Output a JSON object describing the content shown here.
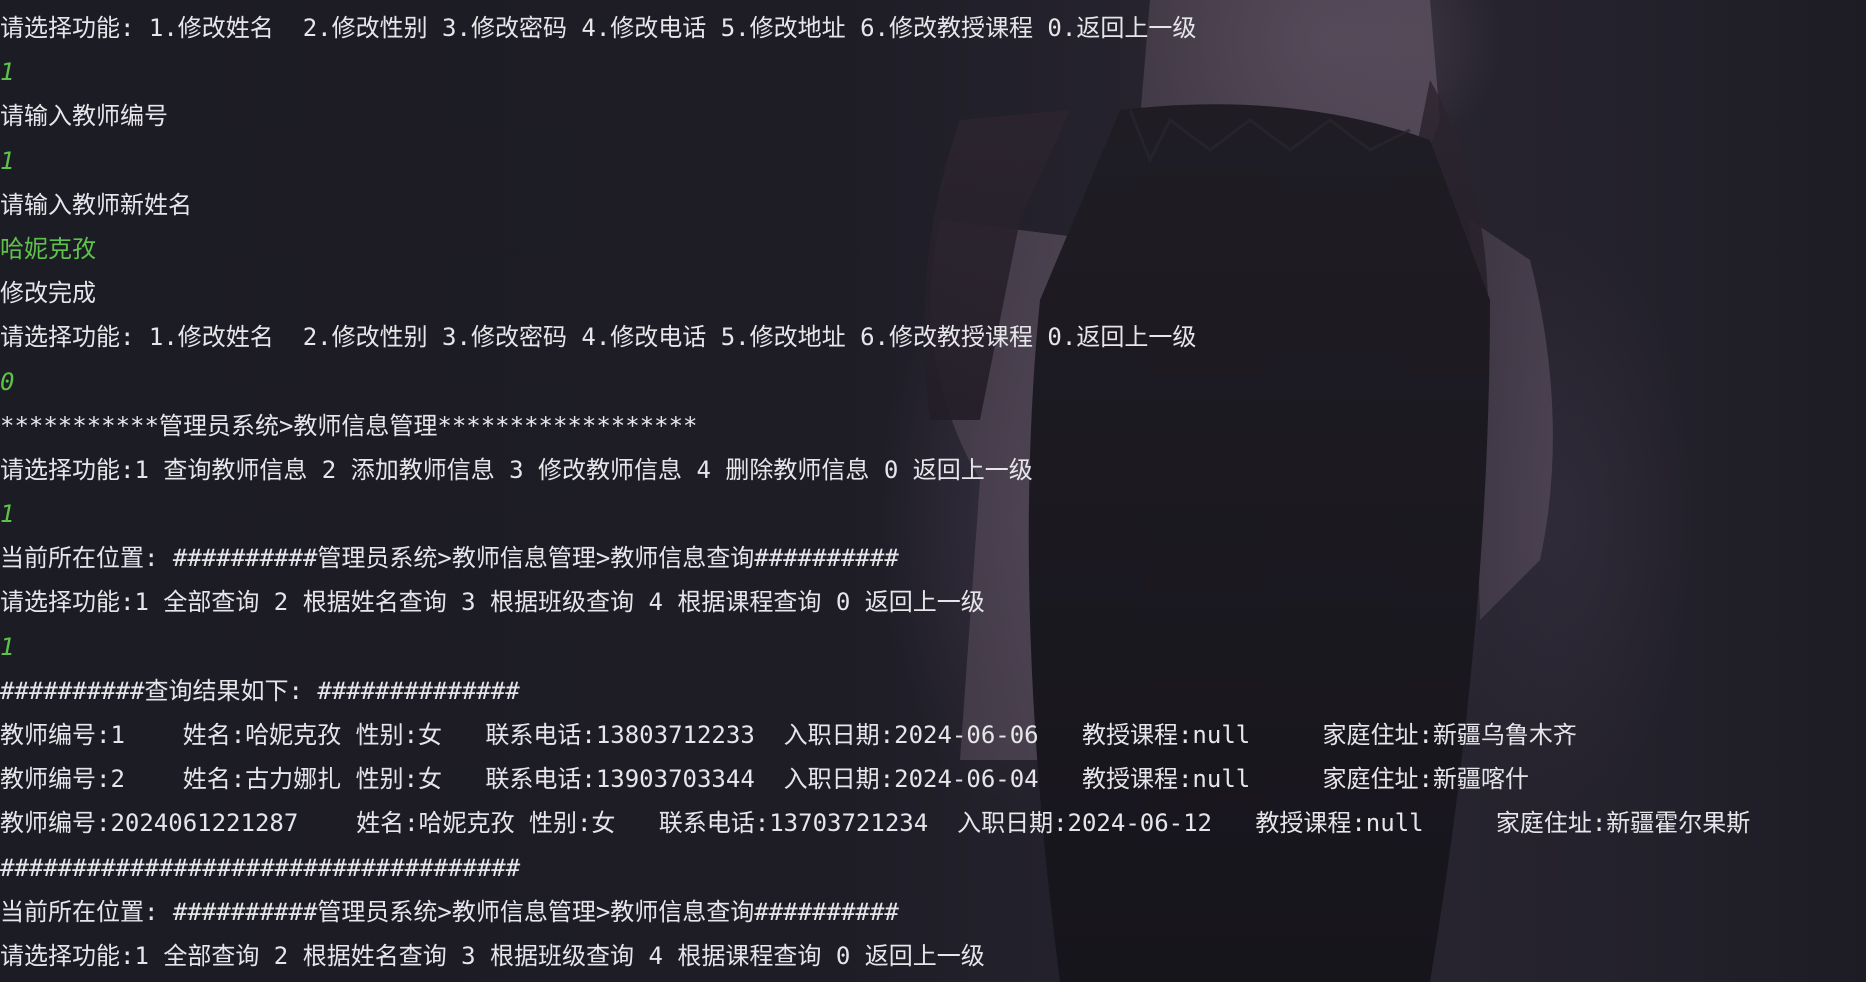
{
  "terminal": {
    "lines": [
      {
        "text": "请选择功能: 1.修改姓名  2.修改性别 3.修改密码 4.修改电话 5.修改地址 6.修改教授课程 0.返回上一级",
        "kind": "output"
      },
      {
        "text": "1",
        "kind": "input"
      },
      {
        "text": "请输入教师编号",
        "kind": "output"
      },
      {
        "text": "1",
        "kind": "input"
      },
      {
        "text": "请输入教师新姓名",
        "kind": "output"
      },
      {
        "text": "哈妮克孜",
        "kind": "input"
      },
      {
        "text": "修改完成",
        "kind": "output"
      },
      {
        "text": "请选择功能: 1.修改姓名  2.修改性别 3.修改密码 4.修改电话 5.修改地址 6.修改教授课程 0.返回上一级",
        "kind": "output"
      },
      {
        "text": "0",
        "kind": "input"
      },
      {
        "text": "***********管理员系统>教师信息管理******************",
        "kind": "output"
      },
      {
        "text": "请选择功能:1 查询教师信息 2 添加教师信息 3 修改教师信息 4 删除教师信息 0 返回上一级",
        "kind": "output"
      },
      {
        "text": "1",
        "kind": "input"
      },
      {
        "text": "当前所在位置: ##########管理员系统>教师信息管理>教师信息查询##########",
        "kind": "output"
      },
      {
        "text": "请选择功能:1 全部查询 2 根据姓名查询 3 根据班级查询 4 根据课程查询 0 返回上一级",
        "kind": "output"
      },
      {
        "text": "1",
        "kind": "input"
      },
      {
        "text": "##########查询结果如下: ##############",
        "kind": "output"
      },
      {
        "text": "教师编号:1    姓名:哈妮克孜 性别:女   联系电话:13803712233  入职日期:2024-06-06   教授课程:null     家庭住址:新疆乌鲁木齐",
        "kind": "output"
      },
      {
        "text": "教师编号:2    姓名:古力娜扎 性别:女   联系电话:13903703344  入职日期:2024-06-04   教授课程:null     家庭住址:新疆喀什",
        "kind": "output"
      },
      {
        "text": "教师编号:2024061221287    姓名:哈妮克孜 性别:女   联系电话:13703721234  入职日期:2024-06-12   教授课程:null     家庭住址:新疆霍尔果斯",
        "kind": "output"
      },
      {
        "text": "####################################",
        "kind": "output"
      },
      {
        "text": "当前所在位置: ##########管理员系统>教师信息管理>教师信息查询##########",
        "kind": "output"
      },
      {
        "text": "请选择功能:1 全部查询 2 根据姓名查询 3 根据班级查询 4 根据课程查询 0 返回上一级",
        "kind": "output"
      }
    ]
  },
  "colors": {
    "output_text": "#e6e6ea",
    "input_text": "#5ec24a",
    "background": "#1a1a22"
  }
}
